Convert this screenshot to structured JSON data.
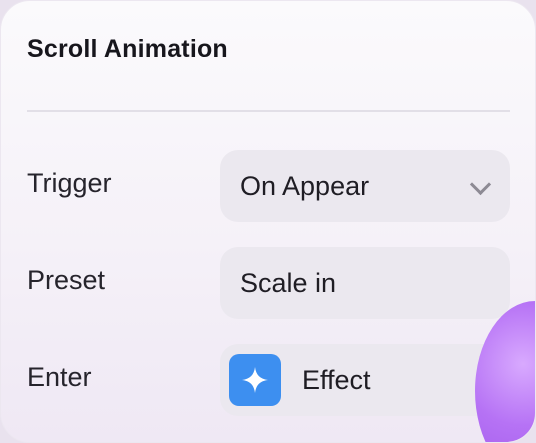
{
  "panel": {
    "title": "Scroll Animation"
  },
  "rows": [
    {
      "label": "Trigger",
      "value": "On Appear"
    },
    {
      "label": "Preset",
      "value": "Scale in"
    },
    {
      "label": "Enter",
      "value": "Effect",
      "icon": "sparkle-icon"
    }
  ],
  "colors": {
    "icon_bg": "#3d8ff0",
    "field_bg": "#ebe8ef",
    "accent_blob": "#b36cf5"
  }
}
